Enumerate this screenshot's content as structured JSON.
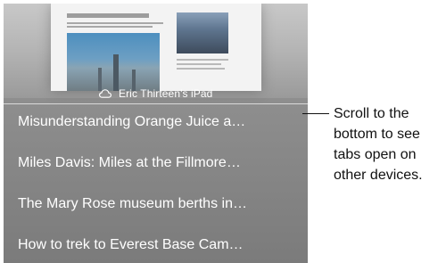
{
  "device": {
    "name": "Eric Thirteen's iPad",
    "icon": "cloud-icon"
  },
  "tabs": [
    {
      "title": "Misunderstanding Orange Juice a…"
    },
    {
      "title": "Miles Davis: Miles at the Fillmore…"
    },
    {
      "title": "The Mary Rose museum berths in…"
    },
    {
      "title": "How to trek to Everest Base Cam…"
    }
  ],
  "callout": {
    "lines": [
      "Scroll to the",
      "bottom to see",
      "tabs open on",
      "other devices."
    ]
  },
  "colors": {
    "panel_background": "#8f8f8f",
    "tab_text": "#ffffff",
    "callout_text": "#111111"
  }
}
